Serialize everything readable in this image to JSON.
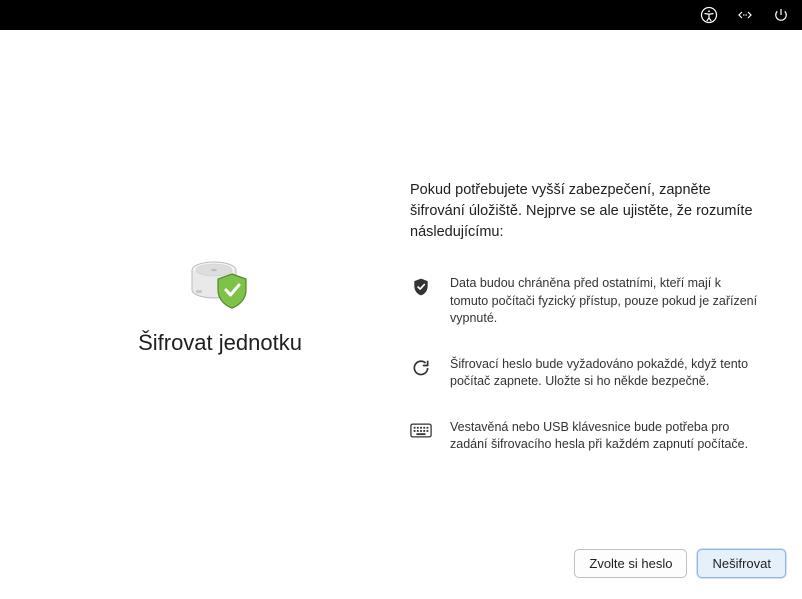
{
  "topbar": {
    "icons": [
      "accessibility-icon",
      "code-expand-icon",
      "power-icon"
    ]
  },
  "page": {
    "title": "Šifrovat jednotku",
    "intro": "Pokud potřebujete vyšší zabezpečení, zapněte šifrování úložiště. Nejprve se ale ujistěte, že rozumíte následujícímu:",
    "bullets": [
      {
        "icon": "shield-check-icon",
        "text": "Data budou chráněna před ostatními, kteří mají k tomuto počítači fyzický přístup, pouze pokud je zařízení vypnuté."
      },
      {
        "icon": "refresh-icon",
        "text": "Šifrovací heslo bude vyžadováno pokaždé, když tento počítač zapnete. Uložte si ho někde bezpečně."
      },
      {
        "icon": "keyboard-icon",
        "text": "Vestavěná nebo USB klávesnice bude potřeba pro zadání šifrovacího hesla při každém zapnutí počítače."
      }
    ]
  },
  "footer": {
    "secondary_label": "Zvolte si heslo",
    "primary_label": "Nešifrovat"
  }
}
